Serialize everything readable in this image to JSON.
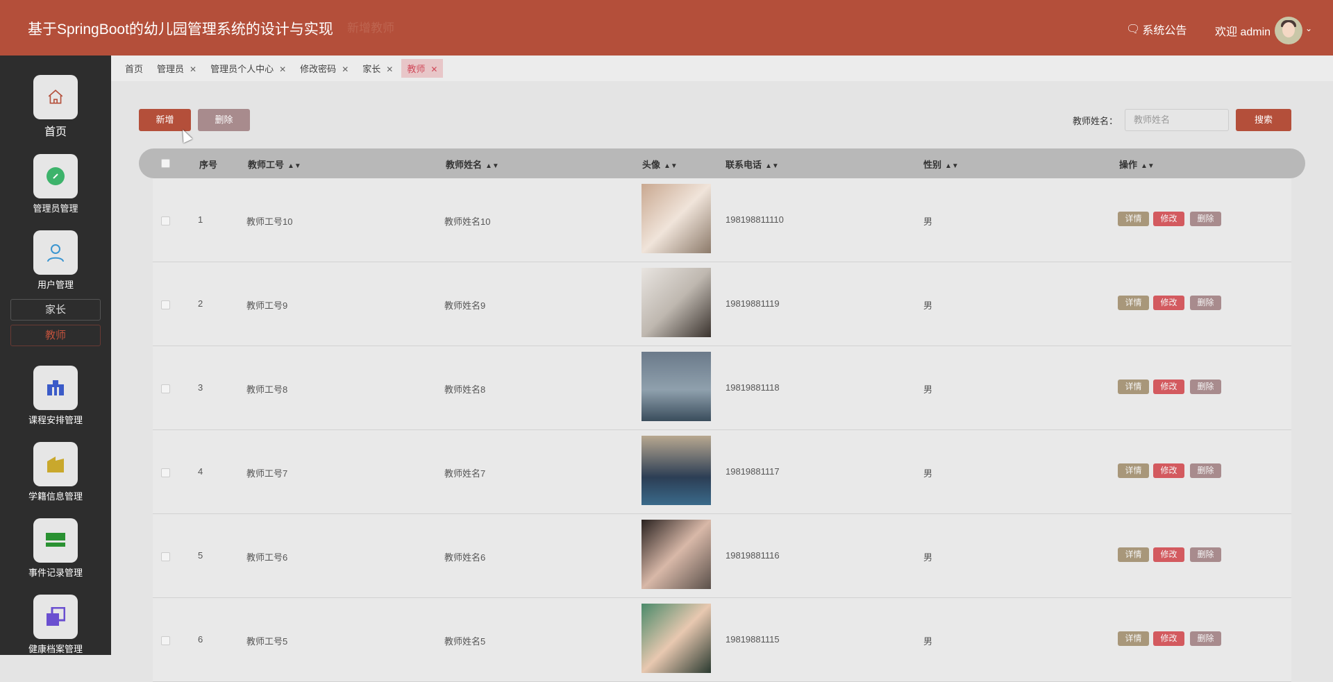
{
  "header": {
    "title": "基于SpringBoot的幼儿园管理系统的设计与实现",
    "notice": "系统公告",
    "welcome": "欢迎 admin",
    "brand_color": "#b44f3a"
  },
  "dialog": {
    "title": "新增教师"
  },
  "sidebar": {
    "items": [
      {
        "label": "首页",
        "icon": "home-icon"
      },
      {
        "label": "管理员管理",
        "icon": "edit-icon"
      },
      {
        "label": "用户管理",
        "icon": "user-icon"
      },
      {
        "label": "课程安排管理",
        "icon": "toolbox-icon"
      },
      {
        "label": "学籍信息管理",
        "icon": "folder-icon"
      },
      {
        "label": "事件记录管理",
        "icon": "layout-icon"
      },
      {
        "label": "健康档案管理",
        "icon": "copy-icon"
      }
    ],
    "subitems": [
      {
        "label": "家长"
      },
      {
        "label": "教师",
        "active": true
      }
    ]
  },
  "tabs": [
    {
      "label": "首页"
    },
    {
      "label": "管理员"
    },
    {
      "label": "管理员个人中心"
    },
    {
      "label": "修改密码"
    },
    {
      "label": "家长"
    },
    {
      "label": "教师",
      "active": true
    }
  ],
  "toolbar": {
    "add": "新增",
    "delete": "删除",
    "search_label": "教师姓名：",
    "search_placeholder": "教师姓名",
    "search": "搜索"
  },
  "table": {
    "headers": [
      "序号",
      "教师工号",
      "教师姓名",
      "头像",
      "联系电话",
      "性别",
      "操作"
    ],
    "actions": {
      "detail": "详情",
      "edit": "修改",
      "delete": "删除"
    },
    "rows": [
      {
        "no": "1",
        "id": "教师工号10",
        "name": "教师姓名10",
        "phone": "198198811110",
        "gender": "男"
      },
      {
        "no": "2",
        "id": "教师工号9",
        "name": "教师姓名9",
        "phone": "19819881119",
        "gender": "男"
      },
      {
        "no": "3",
        "id": "教师工号8",
        "name": "教师姓名8",
        "phone": "19819881118",
        "gender": "男"
      },
      {
        "no": "4",
        "id": "教师工号7",
        "name": "教师姓名7",
        "phone": "19819881117",
        "gender": "男"
      },
      {
        "no": "5",
        "id": "教师工号6",
        "name": "教师姓名6",
        "phone": "19819881116",
        "gender": "男"
      },
      {
        "no": "6",
        "id": "教师工号5",
        "name": "教师姓名5",
        "phone": "19819881115",
        "gender": "男"
      }
    ]
  }
}
